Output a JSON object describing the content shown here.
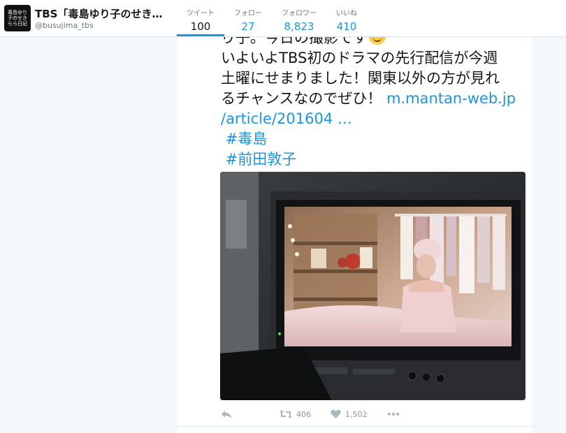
{
  "profile": {
    "name": "TBS「毒島ゆり子のせきらら日記」",
    "handle": "@busujima_tbs",
    "avatar_text": "毒島ゆり子のせきらら日記"
  },
  "stats": [
    {
      "label": "ツイート",
      "value": "100"
    },
    {
      "label": "フォロー",
      "value": "27"
    },
    {
      "label": "フォロワー",
      "value": "8,823"
    },
    {
      "label": "いいね",
      "value": "410"
    }
  ],
  "tweet": {
    "line1": "り子。今日の撮影です",
    "line2": "いよいよTBS初のドラマの先行配信が今週",
    "line3": "土曜にせまりました！関東以外の方が見れ",
    "line4_text": "るチャンスなのでぜひ！",
    "link_a": "m.mantan-web.jp",
    "link_b": "/article/201604 …",
    "hashtag1": "#毒島",
    "hashtag2": "#前田敦子"
  },
  "actions": {
    "reply_icon": "reply-icon",
    "retweet_count": "406",
    "like_count": "1,502",
    "more_icon": "more-icon"
  },
  "colors": {
    "accent": "#1b95e0",
    "text": "#14171a",
    "muted": "#657786"
  }
}
